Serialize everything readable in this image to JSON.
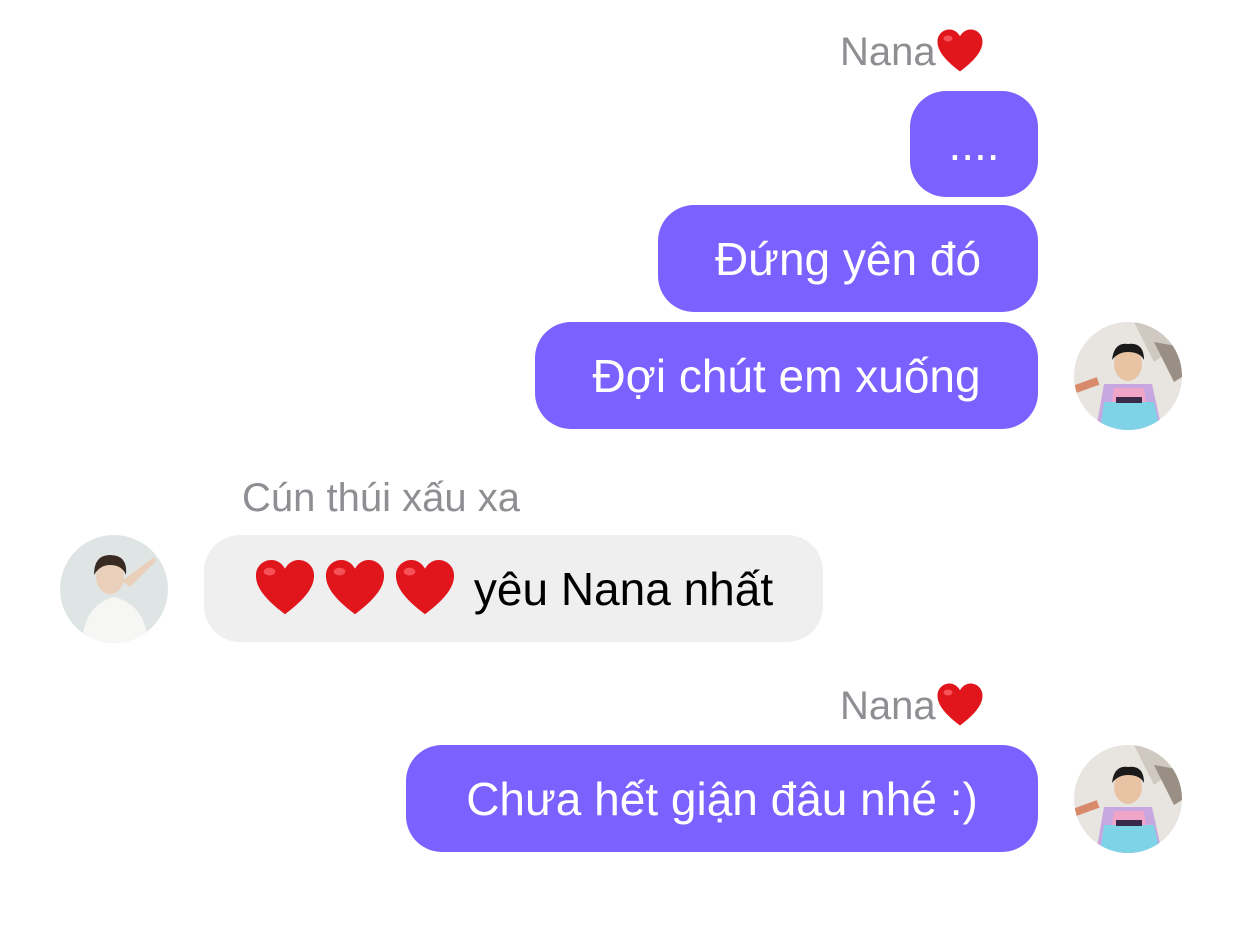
{
  "conversation": {
    "group1": {
      "sender": "Nana",
      "messages": [
        "....",
        "Đứng yên đó",
        "Đợi chút em xuống"
      ]
    },
    "group2": {
      "sender": "Cún thúi xấu xa",
      "message_text": "yêu Nana nhất"
    },
    "group3": {
      "sender": "Nana",
      "message": "Chưa hết giận đâu nhé :)"
    }
  },
  "colors": {
    "outgoing_bubble": "#7b61ff",
    "incoming_bubble": "#efefef",
    "sender_name": "#8e8e93",
    "heart": "#e0161c"
  },
  "icons": {
    "sender_suffix": "heart-icon",
    "incoming_prefix": [
      "heart-icon",
      "heart-icon",
      "heart-icon"
    ]
  }
}
